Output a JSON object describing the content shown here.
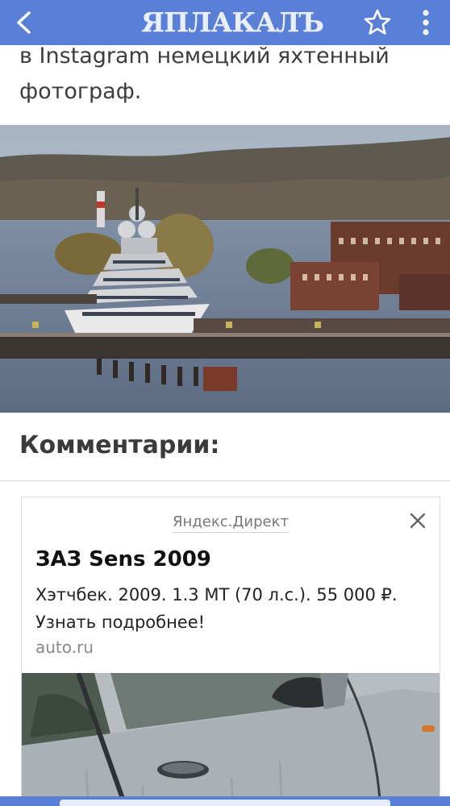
{
  "header": {
    "logo_text": "ЯПЛАКАЛЪ",
    "back_icon": "arrow-left-icon",
    "favorite_icon": "star-outline-icon",
    "menu_icon": "more-vertical-icon",
    "bar_color": "#5a7fd6"
  },
  "article": {
    "text_line_1": "в Instagram немецкий яхтенный",
    "text_line_2": "фотограф."
  },
  "comments": {
    "title": "Комментарии:"
  },
  "ad": {
    "source": "Яндекс.Директ",
    "close_icon": "close-icon",
    "title": "ЗАЗ Sens 2009",
    "description": "Хэтчбек. 2009. 1.3 MT (70 л.с.). 55 000 ₽. Узнать подробнее!",
    "domain": "auto.ru"
  }
}
